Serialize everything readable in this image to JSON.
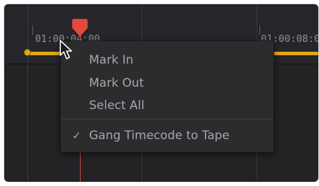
{
  "timeline": {
    "timecodes": [
      "01:00:04:00",
      "01:00:08:0"
    ],
    "colors": {
      "background": "#232326",
      "track": "#e4a817",
      "playhead": "#e5483d"
    }
  },
  "context_menu": {
    "items": [
      {
        "label": "Mark In",
        "checked": false
      },
      {
        "label": "Mark Out",
        "checked": false
      },
      {
        "label": "Select All",
        "checked": false
      },
      {
        "label": "Gang Timecode to Tape",
        "checked": true
      }
    ],
    "check_glyph": "✓"
  },
  "icons": {
    "playhead": "playhead-marker-icon",
    "cursor": "mouse-pointer-icon"
  }
}
